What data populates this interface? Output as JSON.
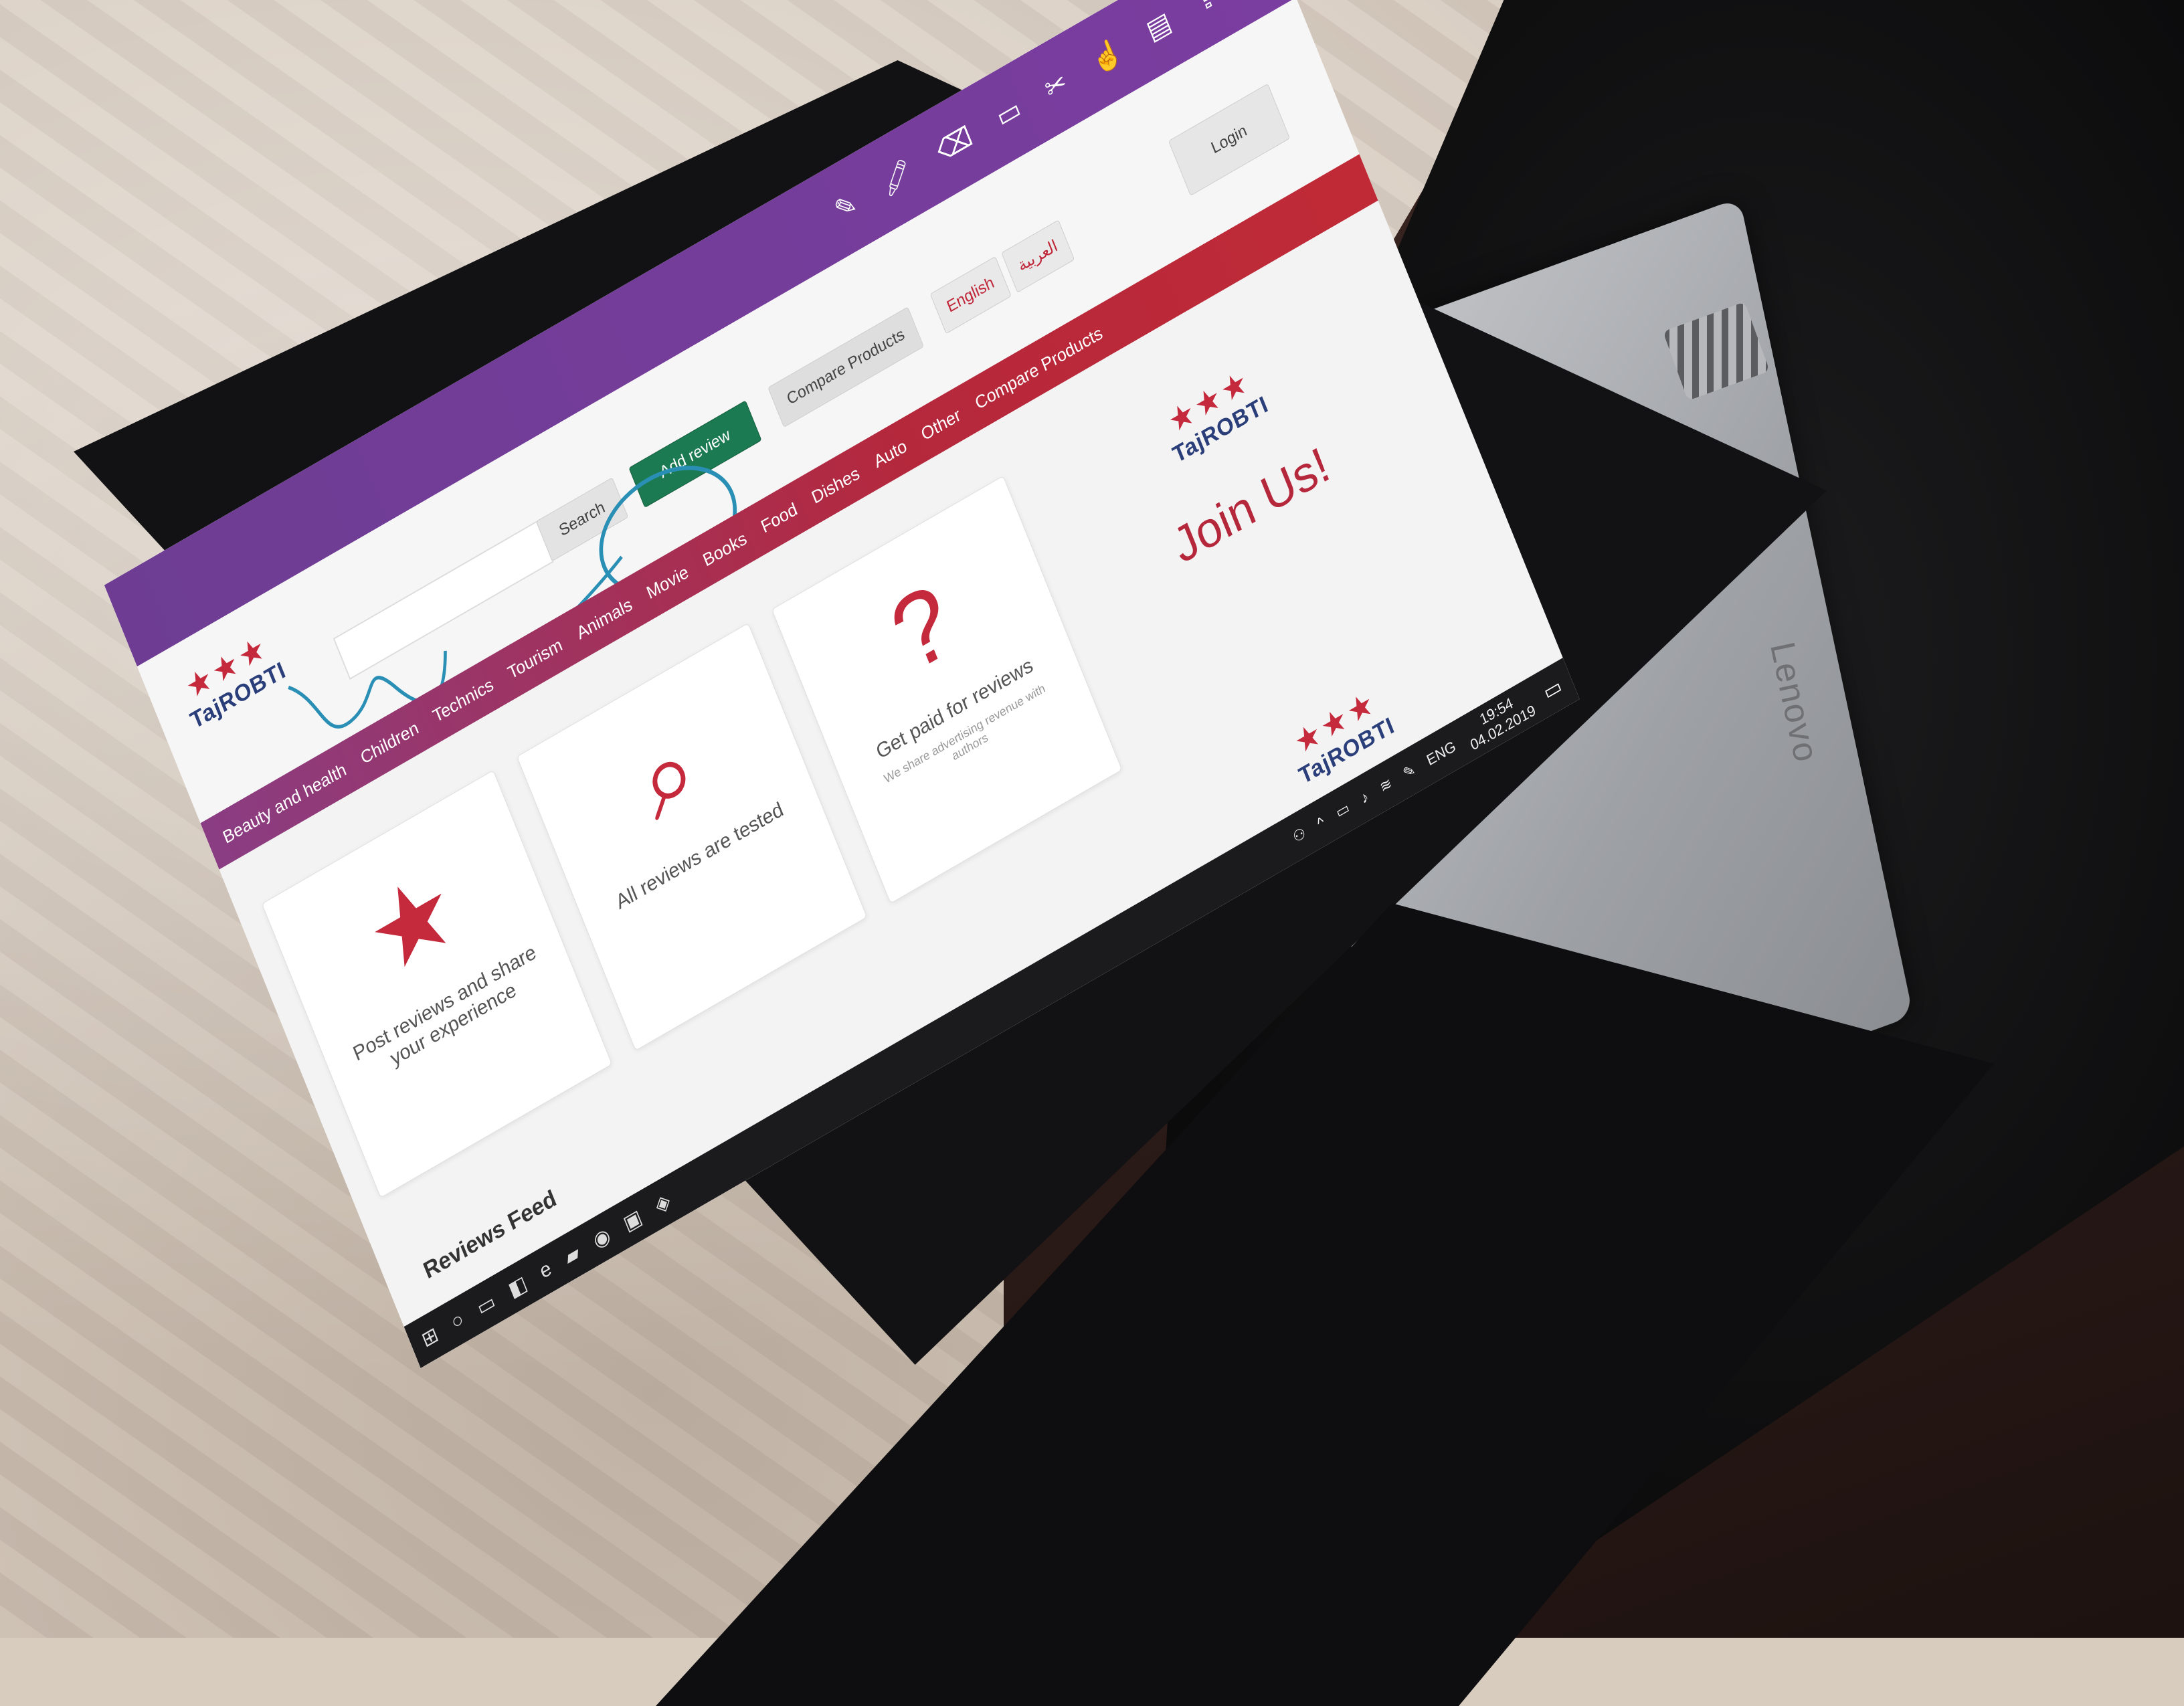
{
  "app": {
    "title": "",
    "window_controls": [
      "–",
      "▢",
      "✕"
    ]
  },
  "toolbar": {
    "icons": [
      "pen-icon",
      "highlighter-icon",
      "eraser-icon",
      "comment-icon",
      "clip-icon",
      "touch-icon",
      "save-icon",
      "share-icon"
    ],
    "close": "✕"
  },
  "header": {
    "logo_text": "TajROBTI",
    "search_placeholder": "",
    "search_button": "Search",
    "add_review_button": "Add review",
    "compare_button": "Compare Products",
    "lang_english": "English",
    "lang_arabic": "العربية",
    "login_button": "Login"
  },
  "nav": {
    "items": [
      "Beauty and health",
      "Children",
      "Technics",
      "Tourism",
      "Animals",
      "Movie",
      "Books",
      "Food",
      "Dishes",
      "Auto",
      "Other",
      "Compare Products"
    ]
  },
  "cards": [
    {
      "icon": "★",
      "title": "Post reviews and share your experience",
      "desc": ""
    },
    {
      "icon": "⌕",
      "title": "All reviews are tested",
      "desc": ""
    },
    {
      "icon": "?",
      "title": "Get paid for reviews",
      "desc": "We share advertising revenue with authors"
    }
  ],
  "join": {
    "title": "Join Us!"
  },
  "feed": {
    "title": "Reviews Feed"
  },
  "taskbar": {
    "icons": [
      "start-icon",
      "search-icon",
      "taskview-icon",
      "app-icon",
      "explorer-icon",
      "folder-icon",
      "chrome-icon",
      "store-icon",
      "browser-icon"
    ],
    "lang": "ENG",
    "time": "19:54",
    "date": "04.02.2019"
  },
  "laptop": {
    "brand": "Lenovo"
  },
  "colors": {
    "purple": "#7a3da0",
    "red": "#c02a36",
    "green": "#1c7a52",
    "navy": "#2a3e7a"
  }
}
